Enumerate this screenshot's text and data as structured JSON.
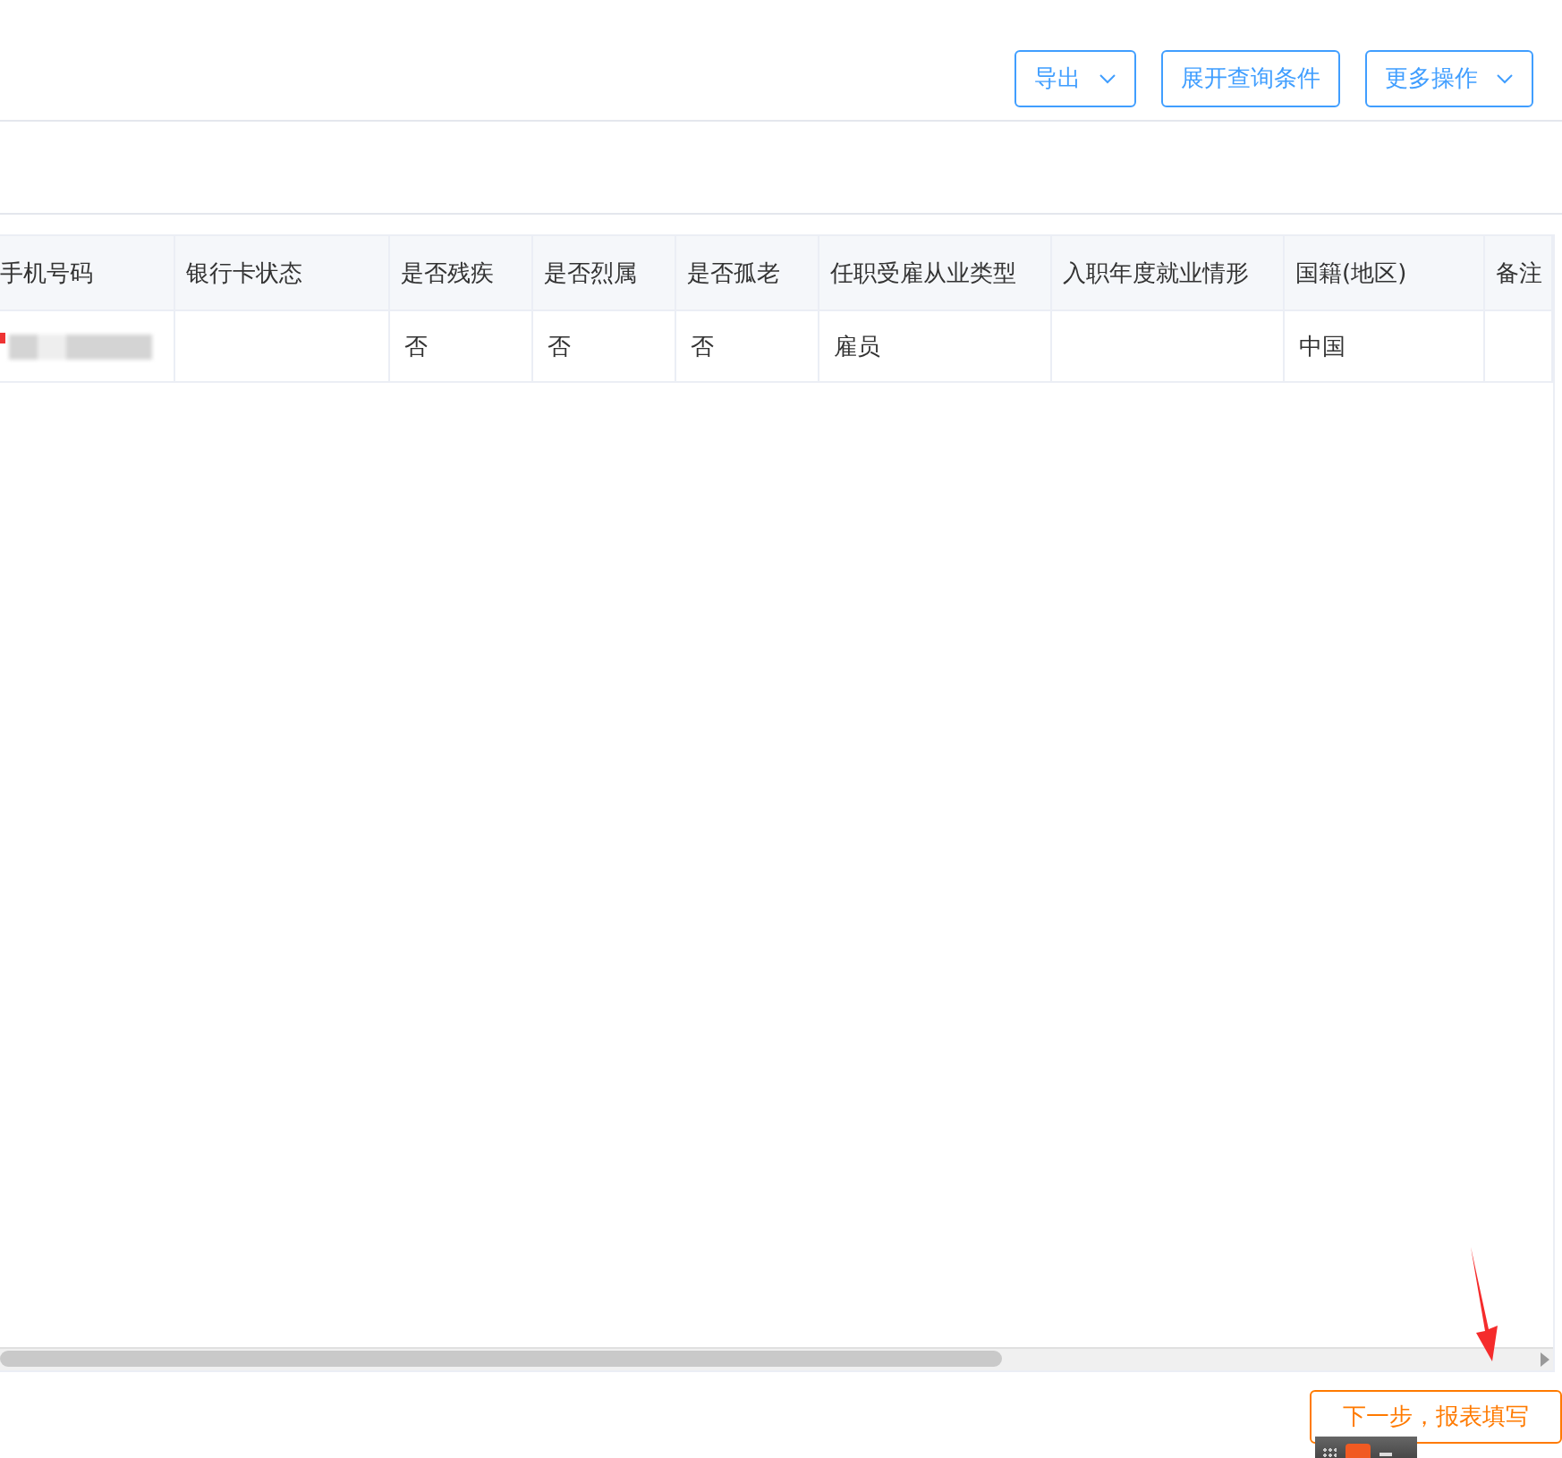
{
  "toolbar": {
    "buttons": [
      {
        "label": "导出",
        "kind": "dropdown"
      },
      {
        "label": "展开查询条件",
        "kind": "plain"
      },
      {
        "label": "更多操作",
        "kind": "dropdown"
      }
    ]
  },
  "table": {
    "columns": [
      "手机号码",
      "银行卡状态",
      "是否残疾",
      "是否烈属",
      "是否孤老",
      "任职受雇从业类型",
      "入职年度就业情形",
      "国籍(地区)",
      "备注"
    ],
    "rows": [
      [
        "",
        "",
        "否",
        "否",
        "否",
        "雇员",
        "",
        "中国",
        ""
      ]
    ]
  },
  "next_button": {
    "label": "下一步，报表填写"
  }
}
